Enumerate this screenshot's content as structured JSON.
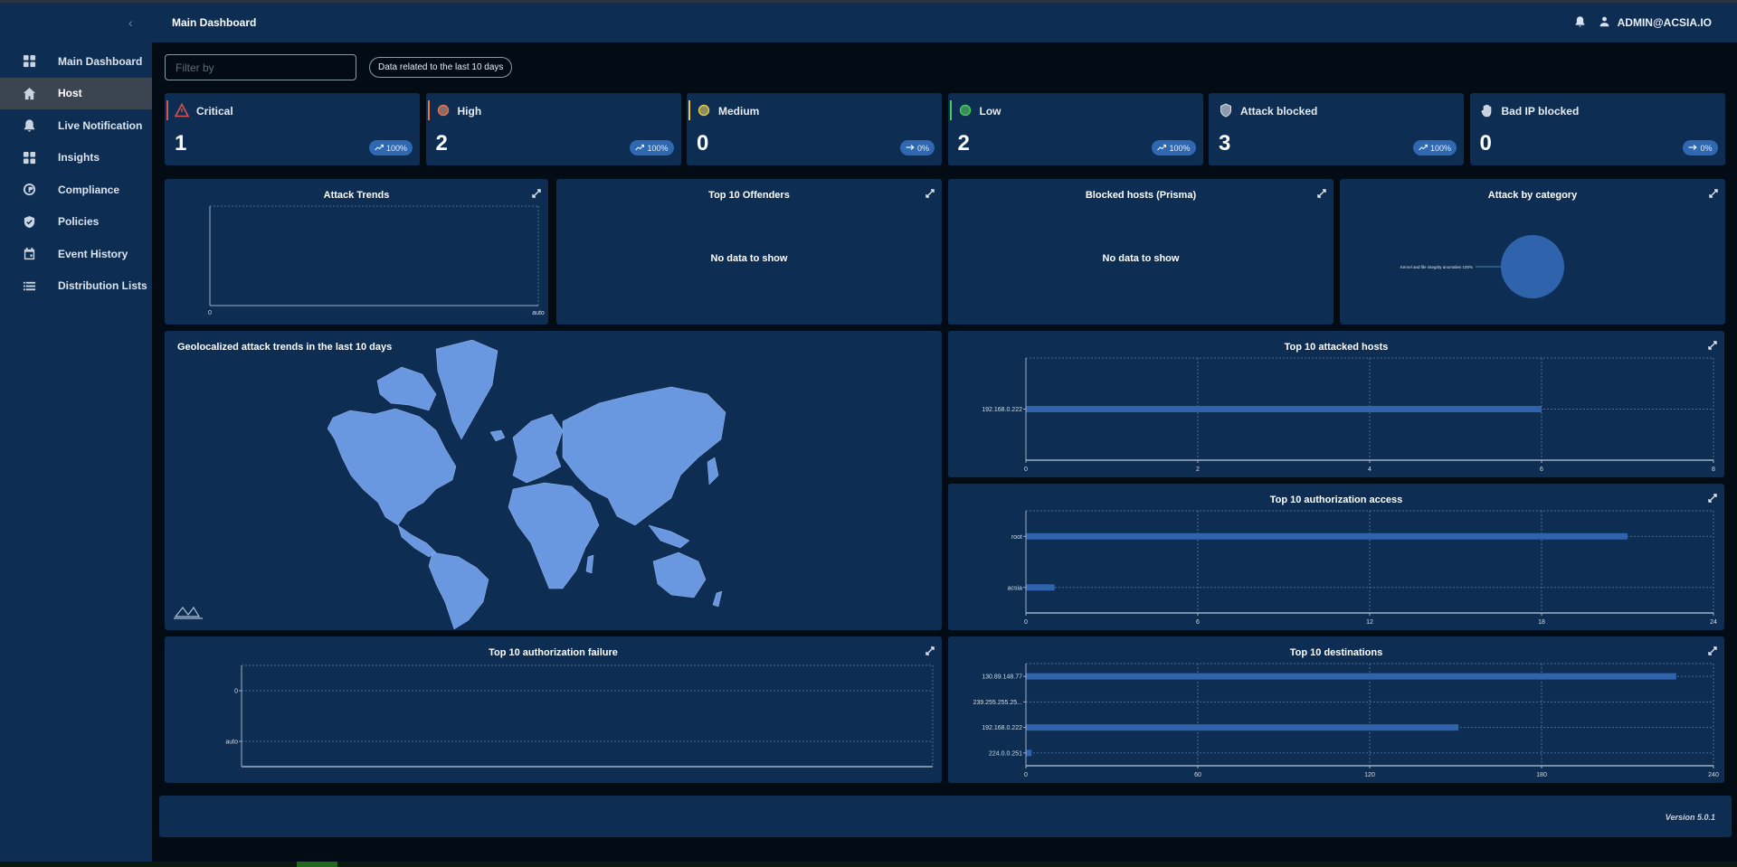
{
  "header": {
    "title": "Main Dashboard",
    "user": "ADMIN@ACSIA.IO"
  },
  "sidebar": {
    "collapse_glyph": "‹",
    "items": [
      {
        "label": "Main Dashboard",
        "icon": "dashboard-grid-icon",
        "active": false
      },
      {
        "label": "Host",
        "icon": "home-icon",
        "active": true
      },
      {
        "label": "Live Notification",
        "icon": "bell-icon",
        "active": false
      },
      {
        "label": "Insights",
        "icon": "insights-grid-icon",
        "active": false
      },
      {
        "label": "Compliance",
        "icon": "compliance-icon",
        "active": false
      },
      {
        "label": "Policies",
        "icon": "shield-check-icon",
        "active": false
      },
      {
        "label": "Event History",
        "icon": "calendar-icon",
        "active": false
      },
      {
        "label": "Distribution Lists",
        "icon": "list-icon",
        "active": false
      }
    ]
  },
  "filter": {
    "placeholder": "Filter by",
    "value": "",
    "range_label": "Data related to the last 10 days"
  },
  "stats": [
    {
      "label": "Critical",
      "value": "1",
      "trend": "100%",
      "trend_icon": "trending-up-icon",
      "accent": "#d9534f",
      "icon": "warning-triangle-icon"
    },
    {
      "label": "High",
      "value": "2",
      "trend": "100%",
      "trend_icon": "trending-up-icon",
      "accent": "#e8734a",
      "icon": "circle-icon"
    },
    {
      "label": "Medium",
      "value": "0",
      "trend": "0%",
      "trend_icon": "arrow-right-icon",
      "accent": "#e6c84a",
      "icon": "circle-icon"
    },
    {
      "label": "Low",
      "value": "2",
      "trend": "100%",
      "trend_icon": "trending-up-icon",
      "accent": "#3ecf5c",
      "icon": "circle-icon"
    },
    {
      "label": "Attack blocked",
      "value": "3",
      "trend": "100%",
      "trend_icon": "trending-up-icon",
      "accent": "",
      "icon": "shield-icon"
    },
    {
      "label": "Bad IP blocked",
      "value": "0",
      "trend": "0%",
      "trend_icon": "arrow-right-icon",
      "accent": "",
      "icon": "hand-stop-icon"
    }
  ],
  "panels": {
    "attack_trends": {
      "title": "Attack Trends"
    },
    "top_offenders": {
      "title": "Top 10 Offenders",
      "empty": "No data to show"
    },
    "blocked_hosts": {
      "title": "Blocked hosts (Prisma)",
      "empty": "No data to show"
    },
    "attack_category": {
      "title": "Attack by category"
    },
    "geo": {
      "title": "Geolocalized attack trends in the last 10 days"
    },
    "attacked_hosts": {
      "title": "Top 10 attacked hosts"
    },
    "auth_access": {
      "title": "Top 10 authorization access"
    },
    "auth_failure": {
      "title": "Top 10 authorization failure"
    },
    "destinations": {
      "title": "Top 10 destinations"
    }
  },
  "footer": {
    "version": "Version 5.0.1"
  },
  "colors": {
    "bar": "#2f64ad",
    "pie": "#2f64ad",
    "map_land": "#6a98e0",
    "panel": "#0d2d52"
  },
  "chart_data": [
    {
      "id": "attack_trends",
      "type": "line",
      "title": "Attack Trends",
      "x_ticks": [
        "0",
        "auto"
      ],
      "series": []
    },
    {
      "id": "attack_category",
      "type": "pie",
      "title": "Attack by category",
      "slices": [
        {
          "label": "Kernel and file integrity anomalies",
          "value": 100,
          "display": "Kernel and file integrity anomalies 100%"
        }
      ]
    },
    {
      "id": "attacked_hosts",
      "type": "bar",
      "orientation": "horizontal",
      "title": "Top 10 attacked hosts",
      "categories": [
        "192.168.0.222"
      ],
      "values": [
        6
      ],
      "xlim": [
        0,
        8
      ],
      "x_ticks": [
        0,
        2,
        4,
        6,
        8
      ]
    },
    {
      "id": "auth_access",
      "type": "bar",
      "orientation": "horizontal",
      "title": "Top 10 authorization access",
      "categories": [
        "root",
        "acsia"
      ],
      "values": [
        21,
        1
      ],
      "xlim": [
        0,
        24
      ],
      "x_ticks": [
        0,
        6,
        12,
        18,
        24
      ]
    },
    {
      "id": "auth_failure",
      "type": "bar",
      "orientation": "horizontal",
      "title": "Top 10 authorization failure",
      "categories": [
        "0",
        "auto"
      ],
      "values": [],
      "x_ticks": []
    },
    {
      "id": "destinations",
      "type": "bar",
      "orientation": "horizontal",
      "title": "Top 10 destinations",
      "categories": [
        "130.89.148.77",
        "239.255.255.25...",
        "192.168.0.222",
        "224.0.0.251"
      ],
      "values": [
        227,
        0,
        151,
        2
      ],
      "xlim": [
        0,
        240
      ],
      "x_ticks": [
        0,
        60,
        120,
        180,
        240
      ]
    }
  ]
}
